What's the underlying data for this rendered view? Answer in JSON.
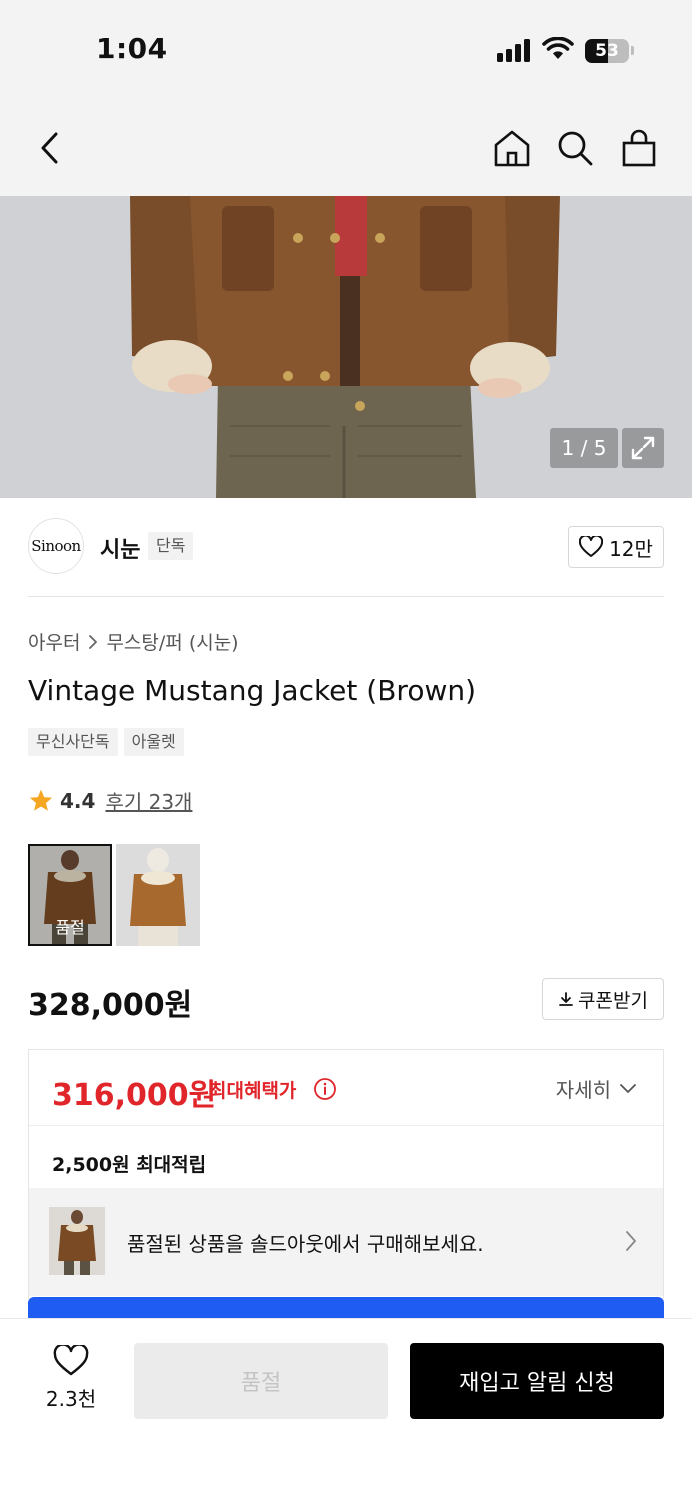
{
  "status_bar": {
    "time": "1:04",
    "battery": "53",
    "battery_level": 0.53
  },
  "nav": {
    "back_icon": "back-chevron-icon",
    "home_icon": "home-icon",
    "search_icon": "search-icon",
    "cart_icon": "shopping-bag-icon"
  },
  "hero": {
    "counter": "1 / 5",
    "expand_icon": "expand-icon"
  },
  "brand": {
    "logo_text": "Sinoon",
    "name": "시눈",
    "badge": "단독",
    "likes": "12만"
  },
  "breadcrumb": {
    "category": "아우터",
    "subcategory": "무스탕/퍼 (시눈)"
  },
  "product": {
    "title": "Vintage Mustang Jacket (Brown)",
    "tags": [
      "무신사단독",
      "아울렛"
    ],
    "rating": "4.4",
    "review_link": "후기 23개",
    "swatch_soldout": "품절",
    "price": "328,000원",
    "coupon_label": "쿠폰받기"
  },
  "benefit": {
    "max_price": "316,000원",
    "max_label": "최대혜택가",
    "detail_label": "자세히",
    "points": "2,500원 최대적립",
    "soldout_notice": "품절된 상품을 솔드아웃에서 구매해보세요."
  },
  "bottom": {
    "wish_count": "2.3천",
    "soldout_button": "품절",
    "restock_button": "재입고 알림 신청"
  },
  "colors": {
    "accent_red": "#e0262b",
    "accent_blue": "#1f5cf2",
    "primary_black": "#000000"
  }
}
